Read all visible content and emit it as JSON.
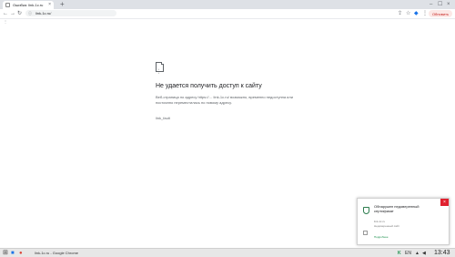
{
  "browser": {
    "tab_title": "Ошибка: link-1c.ru",
    "tab_close": "×",
    "new_tab": "+",
    "win_min": "–",
    "win_max": "☐",
    "win_close": "×",
    "back": "←",
    "forward": "→",
    "reload": "↻",
    "info": "ⓘ",
    "url": "link-1c.ru/",
    "share": "⇪",
    "star": "☆",
    "ext": "◆",
    "menu": "⋮",
    "profile_label": "Обновить",
    "bookmarks": "⋮"
  },
  "error": {
    "eyes": "• •",
    "title": "Не удается получить доступ к сайту",
    "body": "Веб-страница по адресу https://… link-1c.ru/ возможно, временно недоступна или постоянно переместилась по новому адресу.",
    "code": "link_fault"
  },
  "popup": {
    "close": "×",
    "title": "Обнаружен недоверенный сертификат",
    "line1": "link-1c.ru",
    "line2": "Недоверенный сайт",
    "link": "Подробнее"
  },
  "taskbar": {
    "start": "⊞",
    "task_label": "link-1c.ru - Google Chrome",
    "tray_k": "K",
    "tray_lang": "EN",
    "clock": "13:43"
  }
}
